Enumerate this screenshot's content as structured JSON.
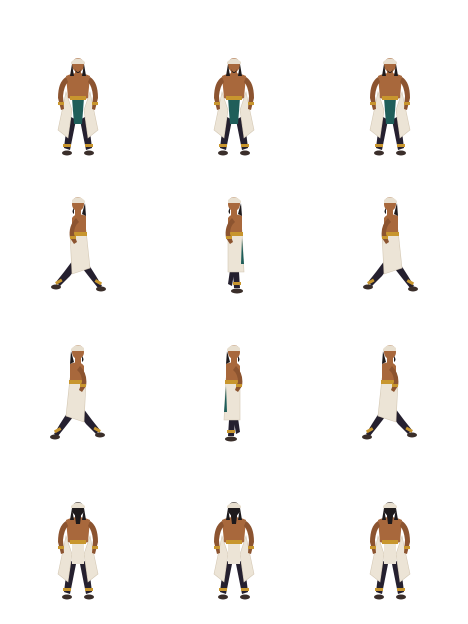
{
  "sprite_sheet": {
    "columns": 3,
    "rows": 4,
    "background": "#ffffff",
    "character": {
      "skin": "#a8683c",
      "skin_shadow": "#8c5430",
      "hair": "#1e1a1c",
      "headband": "#e8dfcf",
      "robe": "#ece4d6",
      "robe_shadow": "#d4c8b4",
      "sash": "#1f5e5a",
      "trousers": "#25202f",
      "gold": "#c8962e",
      "shoes": "#3a2e2a"
    },
    "frames": [
      {
        "row": 0,
        "col": 0,
        "facing": "front",
        "stride": 0
      },
      {
        "row": 0,
        "col": 1,
        "facing": "front",
        "stride": 0
      },
      {
        "row": 0,
        "col": 2,
        "facing": "front",
        "stride": 0
      },
      {
        "row": 1,
        "col": 0,
        "facing": "left",
        "stride": 1
      },
      {
        "row": 1,
        "col": 1,
        "facing": "left",
        "stride": 0
      },
      {
        "row": 1,
        "col": 2,
        "facing": "left",
        "stride": 1
      },
      {
        "row": 2,
        "col": 0,
        "facing": "right",
        "stride": 1
      },
      {
        "row": 2,
        "col": 1,
        "facing": "right",
        "stride": 0
      },
      {
        "row": 2,
        "col": 2,
        "facing": "right",
        "stride": 1
      },
      {
        "row": 3,
        "col": 0,
        "facing": "back",
        "stride": 0
      },
      {
        "row": 3,
        "col": 1,
        "facing": "back",
        "stride": 0
      },
      {
        "row": 3,
        "col": 2,
        "facing": "back",
        "stride": 0
      }
    ]
  }
}
